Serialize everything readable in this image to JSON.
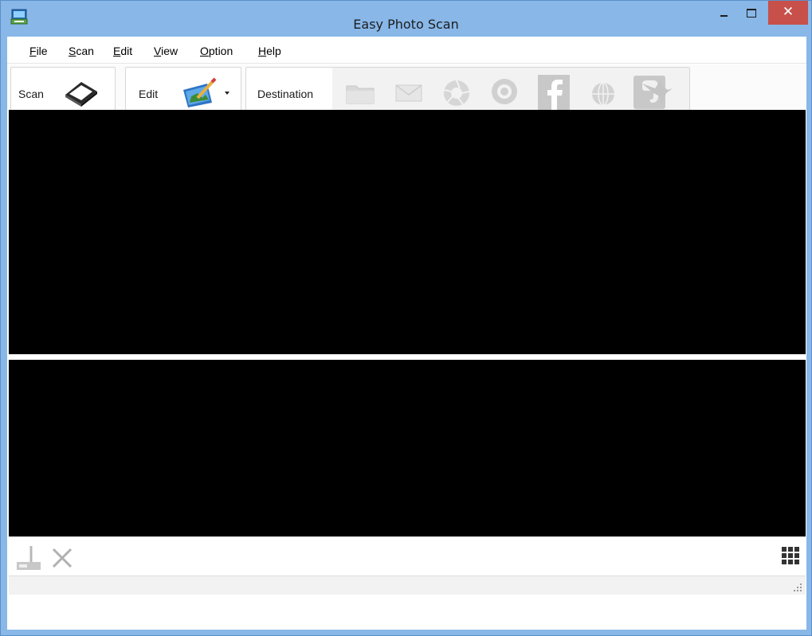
{
  "window": {
    "title": "Easy Photo Scan",
    "close_glyph": "✕"
  },
  "menu": [
    {
      "label": "ile",
      "mnemonic": "F"
    },
    {
      "label": "can",
      "mnemonic": "S"
    },
    {
      "label": "dit",
      "mnemonic": "E"
    },
    {
      "label": "iew",
      "mnemonic": "V"
    },
    {
      "label": "ption",
      "mnemonic": "O"
    },
    {
      "label": "elp",
      "mnemonic": "H"
    }
  ],
  "toolbar": {
    "scan_label": "Scan",
    "edit_label": "Edit",
    "destination_label": "Destination",
    "destinations": [
      "folder-icon",
      "email-icon",
      "photo-share-icon",
      "facebook-icon",
      "web-icon",
      "evernote-icon",
      "hummingbird-icon"
    ]
  },
  "zoom": {
    "value": ""
  },
  "colors": {
    "titlebar": "#88b7e8",
    "close": "#c7504a",
    "preview": "#000000"
  }
}
